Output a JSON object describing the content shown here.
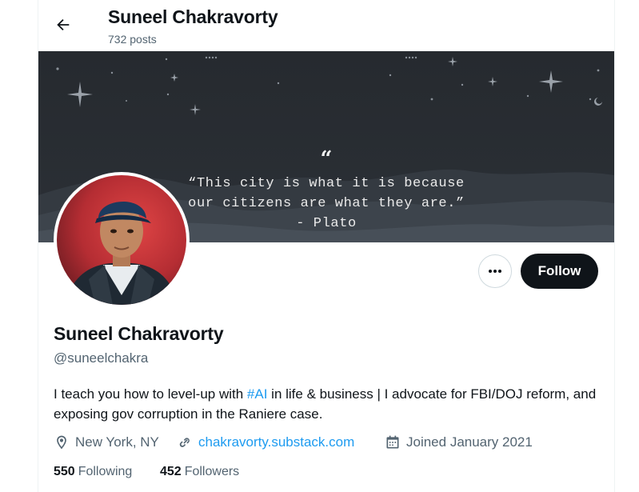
{
  "header": {
    "title": "Suneel Chakravorty",
    "posts_count": "732 posts",
    "back_icon": "arrow-left-icon"
  },
  "banner": {
    "quote_icon": "quote-icon",
    "quote_line1": "“This city is what it is because",
    "quote_line2": "our citizens are what they are.”",
    "quote_line3": "- Plato"
  },
  "profile": {
    "display_name": "Suneel Chakravorty",
    "handle": "@suneelchakra",
    "avatar": "avatar",
    "bio": {
      "part1": "I teach you how to level-up with ",
      "hashtag": "#AI",
      "part2": " in life & business | I advocate for FBI/DOJ reform, and exposing gov corruption in the Raniere case."
    },
    "location": "New York, NY",
    "website": "chakravorty.substack.com",
    "joined": "Joined January 2021",
    "following_count": "550",
    "following_label": "Following",
    "followers_count": "452",
    "followers_label": "Followers"
  },
  "actions": {
    "more_icon": "more-icon",
    "follow_label": "Follow"
  },
  "colors": {
    "accent": "#1d9bf0",
    "text": "#0f1419",
    "secondary": "#536471",
    "button": "#0f1419"
  }
}
